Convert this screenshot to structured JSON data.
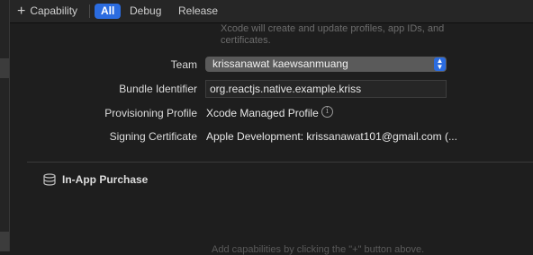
{
  "toolbar": {
    "capability_label": "Capability",
    "tabs": [
      {
        "label": "All",
        "active": true
      },
      {
        "label": "Debug",
        "active": false
      },
      {
        "label": "Release",
        "active": false
      }
    ]
  },
  "signing": {
    "hint_line1": "Xcode will create and update profiles, app IDs, and",
    "hint_line2": "certificates.",
    "team_label": "Team",
    "team_value": "krissanawat kaewsanmuang",
    "bundle_label": "Bundle Identifier",
    "bundle_value": "org.reactjs.native.example.kriss",
    "profile_label": "Provisioning Profile",
    "profile_value": "Xcode Managed Profile",
    "certificate_label": "Signing Certificate",
    "certificate_value": "Apple Development: krissanawat101@gmail.com (..."
  },
  "in_app_purchase": {
    "title": "In-App Purchase"
  },
  "footer": {
    "hint": "Add capabilities by clicking the \"+\" button above."
  },
  "colors": {
    "accent": "#2b6ce0",
    "background": "#1e1e1e"
  }
}
